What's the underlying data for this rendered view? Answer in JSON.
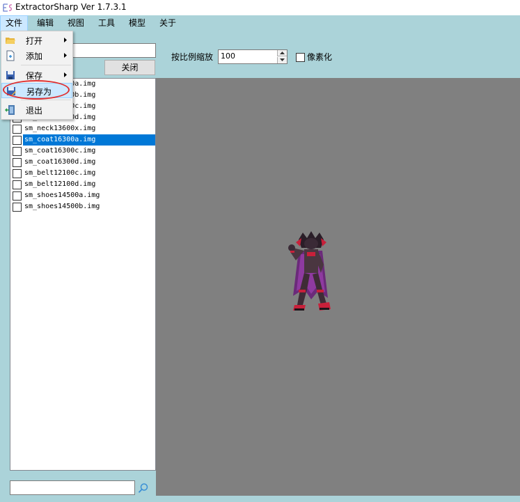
{
  "window": {
    "title": "ExtractorSharp Ver 1.7.3.1"
  },
  "menubar": {
    "items": [
      {
        "label": "文件"
      },
      {
        "label": "编辑"
      },
      {
        "label": "视图"
      },
      {
        "label": "工具"
      },
      {
        "label": "模型"
      },
      {
        "label": "关于"
      }
    ]
  },
  "file_menu": {
    "items": [
      {
        "label": "打开",
        "icon": "open-folder-icon",
        "has_submenu": true
      },
      {
        "label": "添加",
        "icon": "add-file-icon",
        "has_submenu": true
      },
      {
        "label": "保存",
        "icon": "save-disk-icon",
        "has_submenu": true
      },
      {
        "label": "另存为",
        "icon": "save-as-icon",
        "has_submenu": false
      },
      {
        "label": "退出",
        "icon": "exit-icon",
        "has_submenu": false
      }
    ]
  },
  "left_panel": {
    "close_label": "关闭",
    "filter_value": "",
    "search_value": "",
    "files": [
      {
        "name": "sm_neck13600a.img",
        "checked": false,
        "selected": false
      },
      {
        "name": "sm_neck13600b.img",
        "checked": false,
        "selected": false
      },
      {
        "name": "sm_neck13600c.img",
        "checked": false,
        "selected": false
      },
      {
        "name": "sm_neck13600d.img",
        "checked": false,
        "selected": false
      },
      {
        "name": "sm_neck13600x.img",
        "checked": false,
        "selected": false
      },
      {
        "name": "sm_coat16300a.img",
        "checked": false,
        "selected": true
      },
      {
        "name": "sm_coat16300c.img",
        "checked": false,
        "selected": false
      },
      {
        "name": "sm_coat16300d.img",
        "checked": false,
        "selected": false
      },
      {
        "name": "sm_belt12100c.img",
        "checked": false,
        "selected": false
      },
      {
        "name": "sm_belt12100d.img",
        "checked": false,
        "selected": false
      },
      {
        "name": "sm_shoes14500a.img",
        "checked": false,
        "selected": false
      },
      {
        "name": "sm_shoes14500b.img",
        "checked": false,
        "selected": false
      }
    ]
  },
  "toolbar": {
    "zoom_label": "按比例缩放",
    "zoom_value": "100",
    "pixelate_label": "像素化",
    "pixelate_checked": false
  },
  "colors": {
    "background": "#abd3d9",
    "canvas": "#808080",
    "selection": "#0078d7",
    "annotation": "#e03030"
  }
}
